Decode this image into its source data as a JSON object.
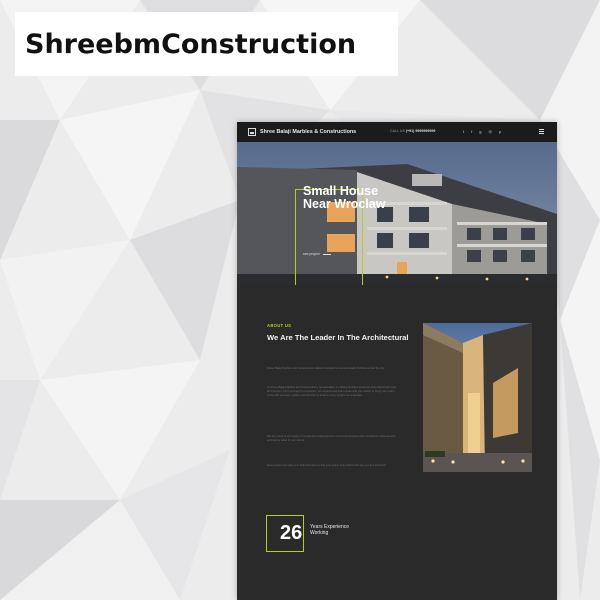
{
  "banner": {
    "title": "ShreebmConstruction"
  },
  "site": {
    "brand": "Shree Balaji Marbles & Constructions",
    "call_label": "CALL US",
    "phone": "(+91) 9999999999",
    "socials": [
      "twitter",
      "facebook",
      "google-plus",
      "instagram",
      "pinterest"
    ],
    "social_glyphs": [
      "t",
      "f",
      "g",
      "◎",
      "p"
    ],
    "hero": {
      "title": "Small House Near Wroclaw",
      "link": "see project"
    },
    "about": {
      "label": "ABOUT US",
      "title": "We Are The Leader In The Architectural",
      "paragraphs": [
        "Shree Balaji Marbles and Constructions delivers durable homes and quality finishes across the city.",
        "At Shree Balaji Marbles and Constructions, we specialize in crafting timeless structures that reflect both style and function. From concept to completion, our experienced team works with you closely to bring your vision to life with precision, quality and attention to detail in every project we undertake.",
        "We are proud of our legacy of completed residential and commercial projects with unmatched craftsmanship and lasting value for our clients.",
        "Every project we take on is built with care so that your space truly reflects the way you live and work."
      ]
    },
    "experience": {
      "number": "26",
      "label": "Years Experience Working"
    }
  },
  "colors": {
    "accent": "#b8cc24",
    "dark_bg": "#2a2a2a",
    "topbar": "#1b1b1b"
  }
}
